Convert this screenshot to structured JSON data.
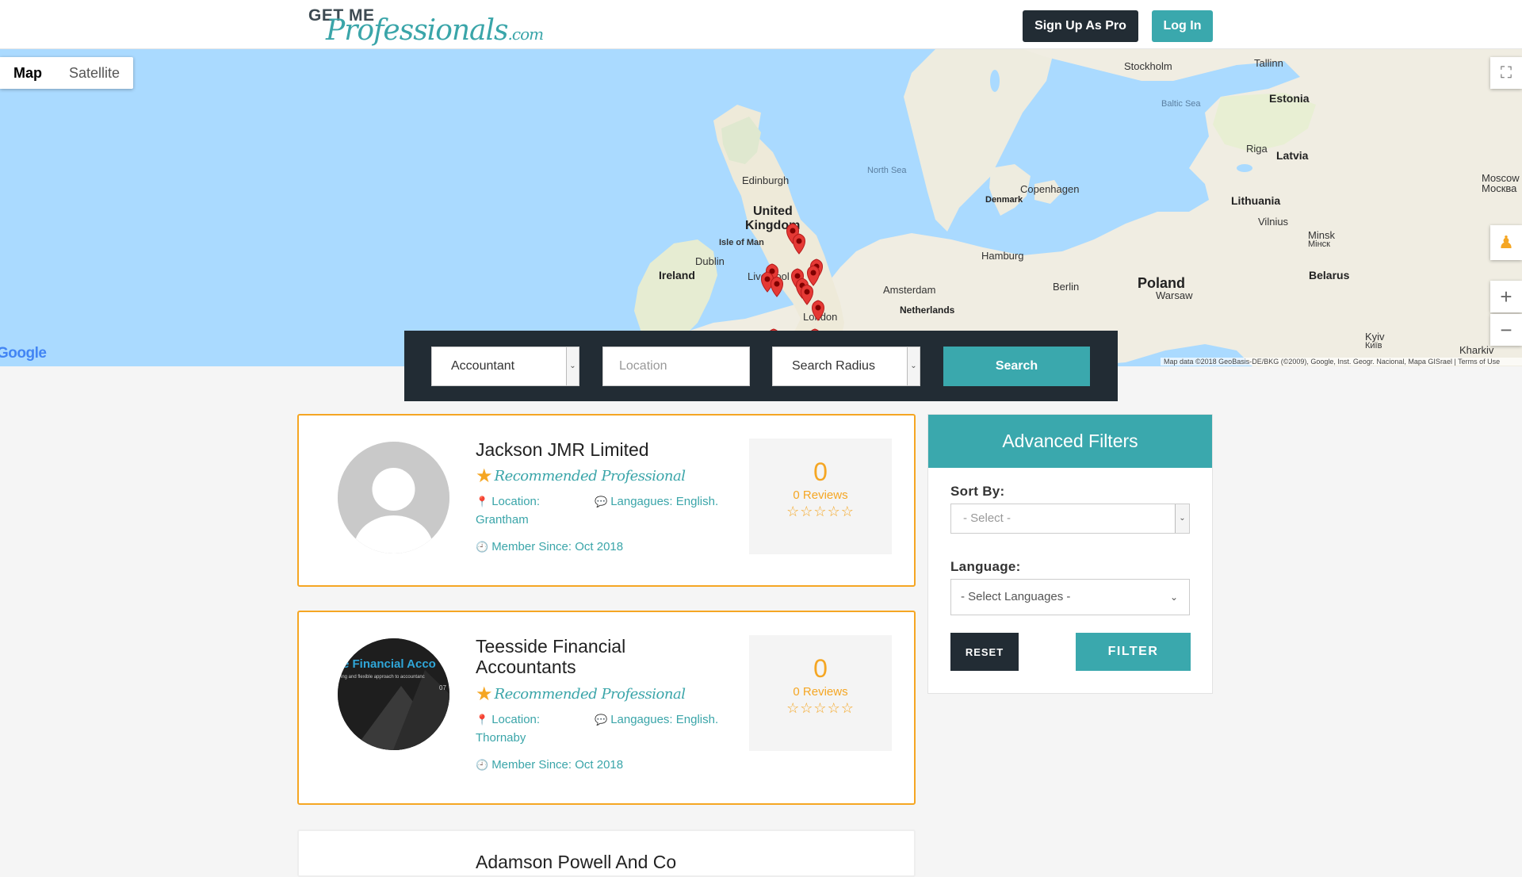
{
  "header": {
    "logo_top": "GET ME",
    "logo_main": "Professionals",
    "logo_com": ".com",
    "signup_label": "Sign Up As Pro",
    "login_label": "Log In"
  },
  "map": {
    "type_map": "Map",
    "type_satellite": "Satellite",
    "labels": {
      "stockholm": "Stockholm",
      "tallinn": "Tallinn",
      "estonia": "Estonia",
      "baltic_sea": "Baltic Sea",
      "riga": "Riga",
      "latvia": "Latvia",
      "moscow": "Moscow",
      "moscow_ru": "Москва",
      "north_sea": "North Sea",
      "edinburgh": "Edinburgh",
      "denmark": "Denmark",
      "copenhagen": "Copenhagen",
      "lithuania": "Lithuania",
      "vilnius": "Vilnius",
      "minsk": "Minsk",
      "minsk_by": "Мінск",
      "united_kingdom_1": "United",
      "united_kingdom_2": "Kingdom",
      "isle_of_man": "Isle of Man",
      "hamburg": "Hamburg",
      "dublin": "Dublin",
      "ireland": "Ireland",
      "liverpool": "Liverpool",
      "belarus": "Belarus",
      "berlin": "Berlin",
      "poland": "Poland",
      "amsterdam": "Amsterdam",
      "netherlands": "Netherlands",
      "warsaw": "Warsaw",
      "london": "London",
      "kyiv": "Kyiv",
      "kyiv_ua": "Київ",
      "kharkiv": "Kharkiv"
    },
    "google": "Google",
    "attribution": "Map data ©2018 GeoBasis-DE/BKG (©2009), Google, Inst. Geogr. Nacional, Mapa GISrael | Terms of Use"
  },
  "search": {
    "profession_value": "Accountant",
    "location_placeholder": "Location",
    "radius_value": "Search Radius",
    "search_label": "Search"
  },
  "results": [
    {
      "name": "Jackson JMR Limited",
      "recommended": "Recommended Professional",
      "location_label": "Location:",
      "location_value": "Grantham",
      "languages": "Langagues: English.",
      "member_since": "Member Since: Oct 2018",
      "review_count": "0",
      "reviews_label": "0 Reviews",
      "stars": "☆☆☆☆☆"
    },
    {
      "name": "Teesside Financial Accountants",
      "recommended": "Recommended Professional",
      "location_label": "Location:",
      "location_value": "Thornaby",
      "languages": "Langagues: English.",
      "member_since": "Member Since: Oct 2018",
      "review_count": "0",
      "reviews_label": "0 Reviews",
      "stars": "☆☆☆☆☆",
      "avatar_text": "e Financial Acco",
      "avatar_subtext": "ing and flexible approach to accountanc",
      "avatar_number": "07"
    },
    {
      "name": "Adamson Powell And Co"
    }
  ],
  "filters": {
    "title": "Advanced Filters",
    "sort_label": "Sort By:",
    "sort_value": "- Select -",
    "language_label": "Language:",
    "language_value": "- Select Languages -",
    "reset_label": "RESET",
    "filter_label": "FILTER"
  },
  "colors": {
    "teal": "#3aa8ad",
    "dark": "#222c34",
    "orange": "#f5a623",
    "marker": "#e53935",
    "water": "#aadaff",
    "land": "#f0ede4"
  }
}
